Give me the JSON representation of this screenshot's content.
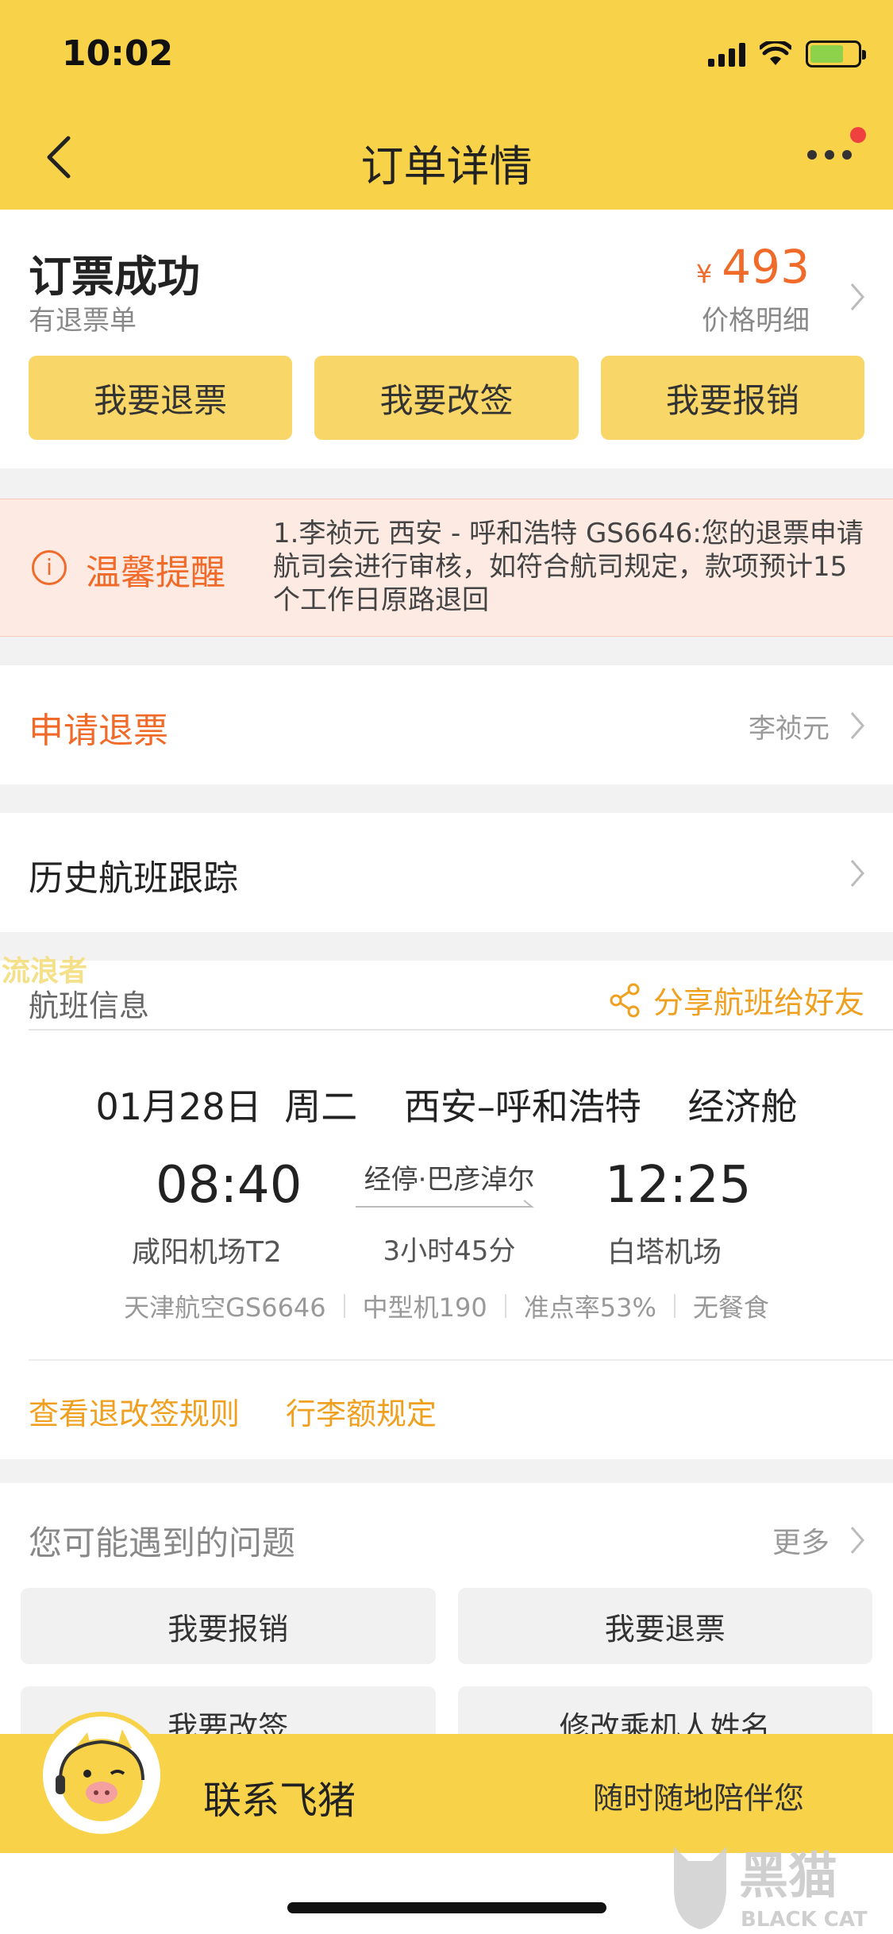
{
  "status_bar": {
    "time": "10:02"
  },
  "nav": {
    "title": "订单详情"
  },
  "order": {
    "status": "订票成功",
    "sub_status": "有退票单",
    "currency": "¥",
    "price": "493",
    "price_detail": "价格明细",
    "actions": [
      "我要退票",
      "我要改签",
      "我要报销"
    ]
  },
  "reminder": {
    "title": "温馨提醒",
    "text": "1.李祯元 西安 - 呼和浩特 GS6646:您的退票申请航司会进行审核，如符合航司规定，款项预计15个工作日原路退回"
  },
  "refund_row": {
    "label": "申请退票",
    "value": "李祯元"
  },
  "history_row": {
    "label": "历史航班跟踪"
  },
  "flight": {
    "section_label": "航班信息",
    "watermark": "流浪者",
    "share_label": "分享航班给好友",
    "date": "01月28日",
    "weekday": "周二",
    "route": "西安–呼和浩特",
    "cabin": "经济舱",
    "dep_time": "08:40",
    "dep_airport": "咸阳机场T2",
    "stopover": "经停·巴彦淖尔",
    "duration": "3小时45分",
    "arr_time": "12:25",
    "arr_airport": "白塔机场",
    "meta": [
      "天津航空GS6646",
      "中型机190",
      "准点率53%",
      "无餐食"
    ],
    "links": [
      "查看退改签规则",
      "行李额规定"
    ]
  },
  "faq": {
    "title": "您可能遇到的问题",
    "more": "更多",
    "items": [
      "我要报销",
      "我要退票",
      "我要改签",
      "修改乘机人姓名"
    ]
  },
  "contact": {
    "title": "联系飞猪",
    "subtitle": "随时随地陪伴您"
  },
  "logo": {
    "cn": "黑猫",
    "en": "BLACK CAT"
  },
  "colors": {
    "brand_yellow": "#f8d34a",
    "accent_orange": "#f06a2a",
    "link_orange": "#f0a020"
  }
}
